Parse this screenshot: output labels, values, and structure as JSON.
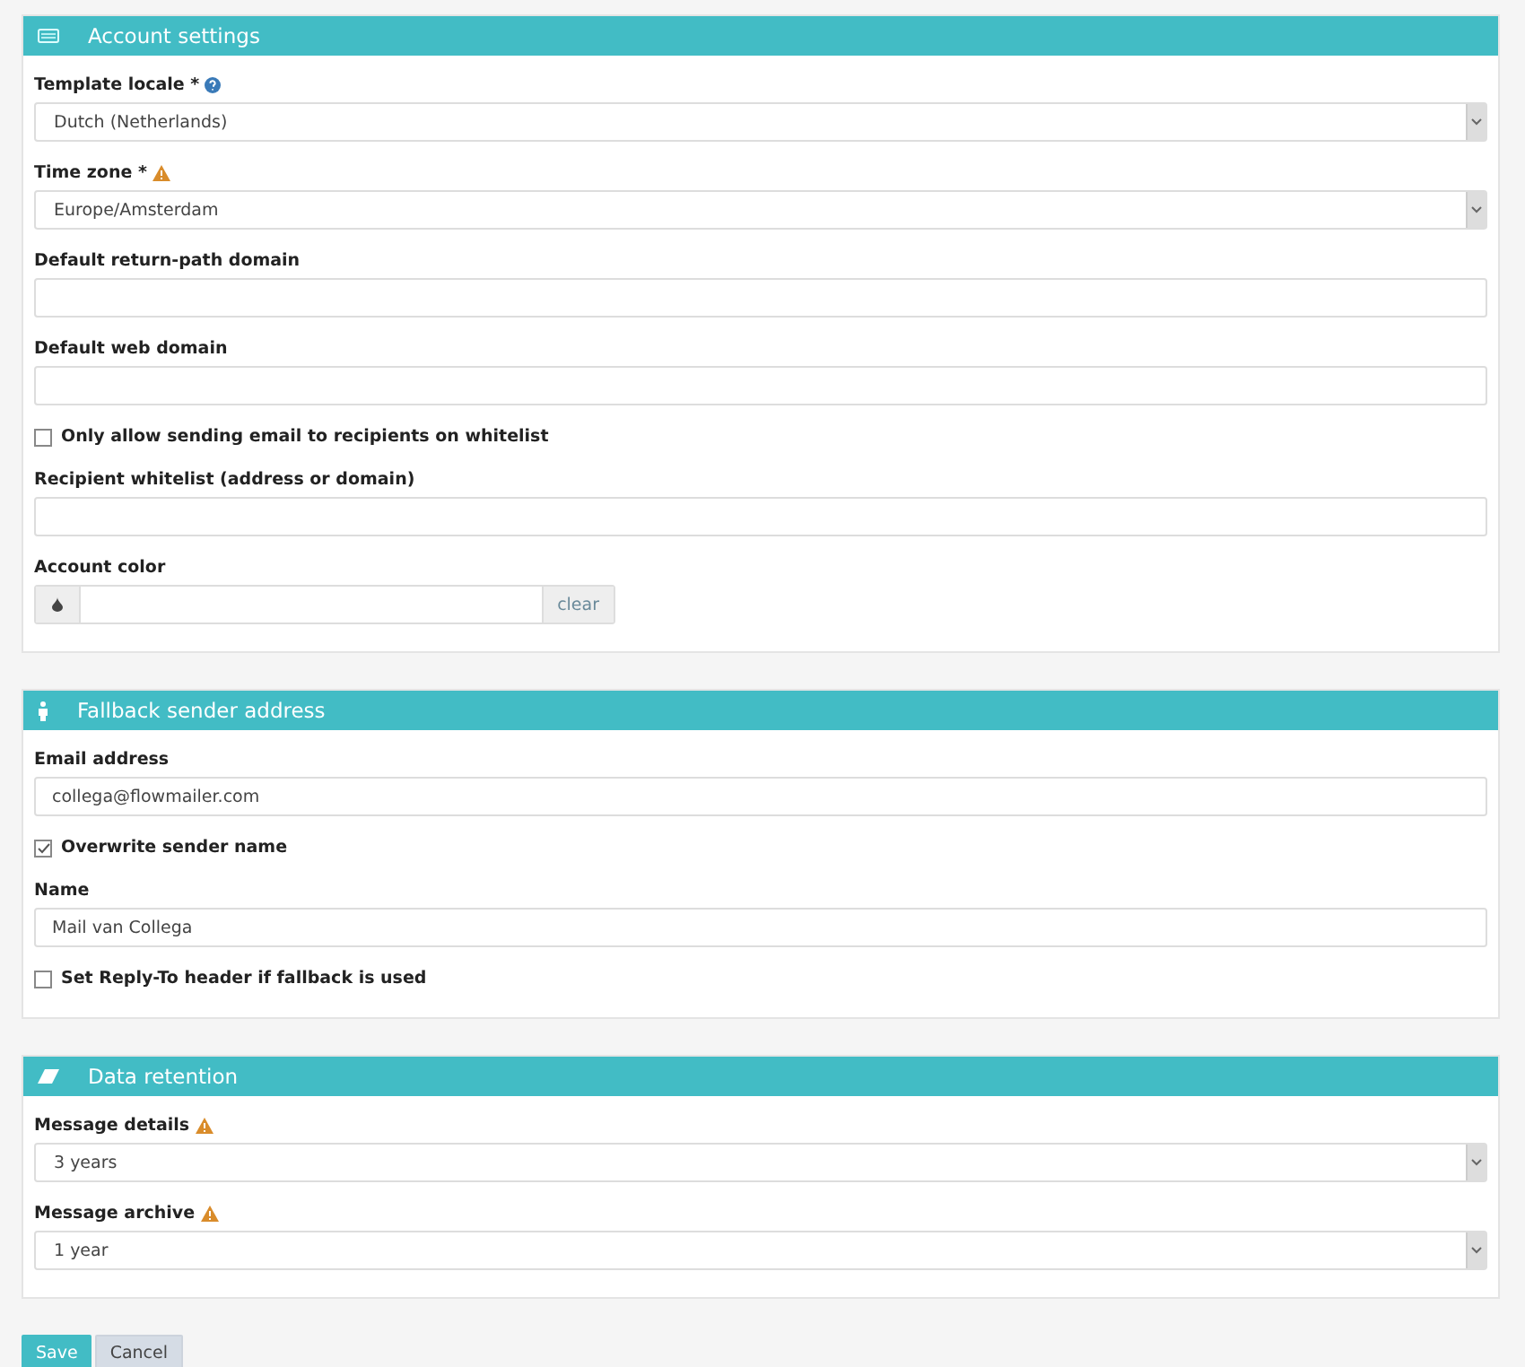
{
  "panels": [
    {
      "title": "Account settings",
      "fields": [
        {
          "kind": "select",
          "label": "Template locale *",
          "help": true,
          "warning": false,
          "value": "Dutch (Netherlands)"
        },
        {
          "kind": "select",
          "label": "Time zone *",
          "help": false,
          "warning": true,
          "value": "Europe/Amsterdam"
        },
        {
          "kind": "text",
          "label": "Default return-path domain"
        },
        {
          "kind": "text",
          "label": "Default web domain"
        },
        {
          "kind": "checkbox",
          "label": "Only allow sending email to recipients on whitelist",
          "checked": false
        },
        {
          "kind": "text",
          "label": "Recipient whitelist (address or domain)"
        },
        {
          "kind": "color",
          "label": "Account color",
          "button": "clear"
        }
      ]
    },
    {
      "title": "Fallback sender address",
      "fields": [
        {
          "kind": "text",
          "label": "Email address",
          "value": "collega@flowmailer.com"
        },
        {
          "kind": "checkbox",
          "label": "Overwrite sender name",
          "checked": true
        },
        {
          "kind": "text",
          "label": "Name",
          "value": "Mail van Collega"
        },
        {
          "kind": "checkbox",
          "label": "Set Reply-To header if fallback is used",
          "checked": false
        }
      ]
    },
    {
      "title": "Data retention",
      "fields": [
        {
          "kind": "select",
          "label": "Message details",
          "help": false,
          "warning": true,
          "value": "3 years"
        },
        {
          "kind": "select",
          "label": "Message archive",
          "help": false,
          "warning": true,
          "value": "1 year"
        }
      ]
    }
  ],
  "buttons": [
    {
      "label": "Save",
      "kind": "primary"
    },
    {
      "label": "Cancel",
      "kind": "secondary"
    }
  ]
}
